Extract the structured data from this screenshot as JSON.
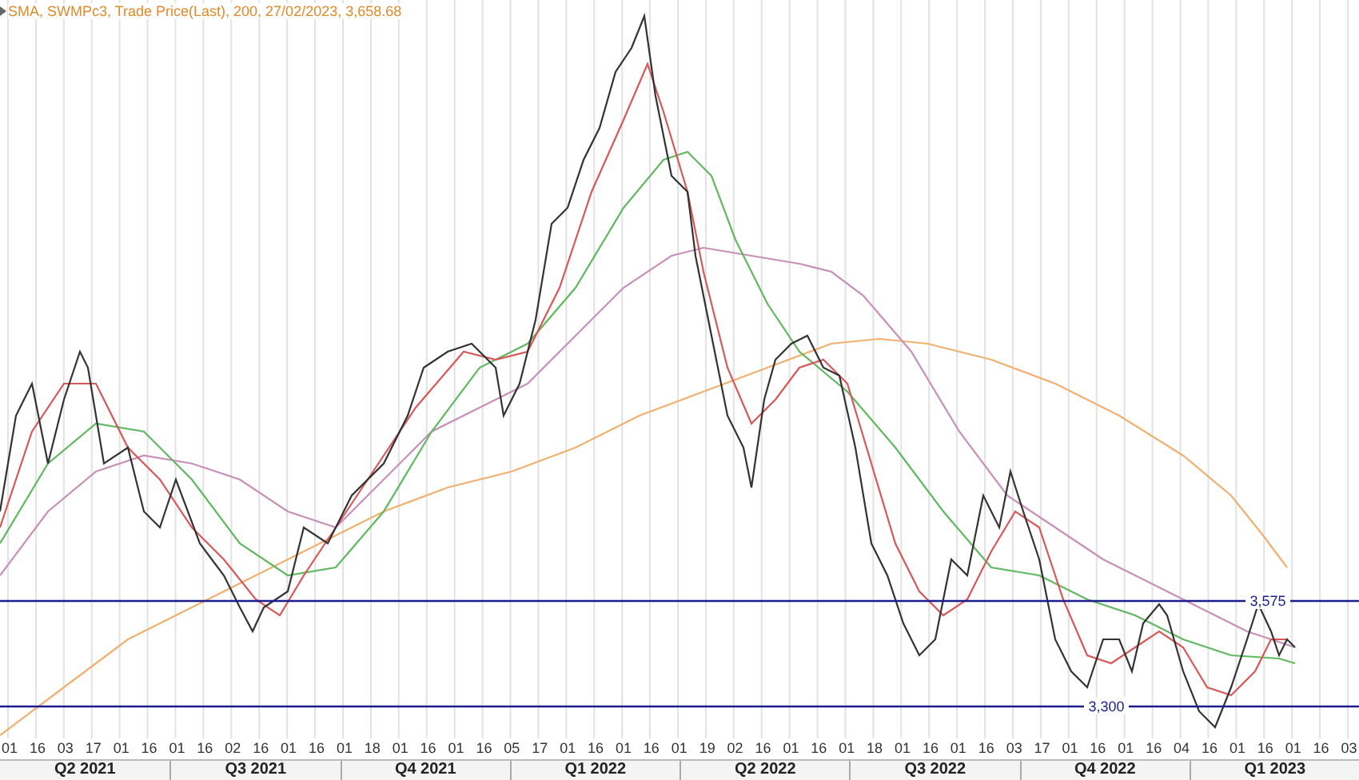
{
  "legend": {
    "text": "SMA, SWMPc3, Trade Price(Last),  200, 27/02/2023, 3,658.68"
  },
  "reference_lines": [
    {
      "label": "3,575"
    },
    {
      "label": "3,300"
    }
  ],
  "x_axis": {
    "ticks": [
      "01",
      "16",
      "03",
      "17",
      "01",
      "16",
      "01",
      "16",
      "02",
      "16",
      "01",
      "16",
      "01",
      "18",
      "01",
      "16",
      "01",
      "16",
      "05",
      "17",
      "01",
      "16",
      "01",
      "16",
      "01",
      "19",
      "02",
      "16",
      "01",
      "16",
      "01",
      "18",
      "01",
      "16",
      "01",
      "16",
      "03",
      "17",
      "01",
      "16",
      "01",
      "16",
      "04",
      "16",
      "01",
      "16",
      "01",
      "16",
      "03"
    ],
    "quarters": [
      "Q2 2021",
      "Q3 2021",
      "Q4 2021",
      "Q1 2022",
      "Q2 2022",
      "Q3 2022",
      "Q4 2022",
      "Q1 2023"
    ]
  }
}
